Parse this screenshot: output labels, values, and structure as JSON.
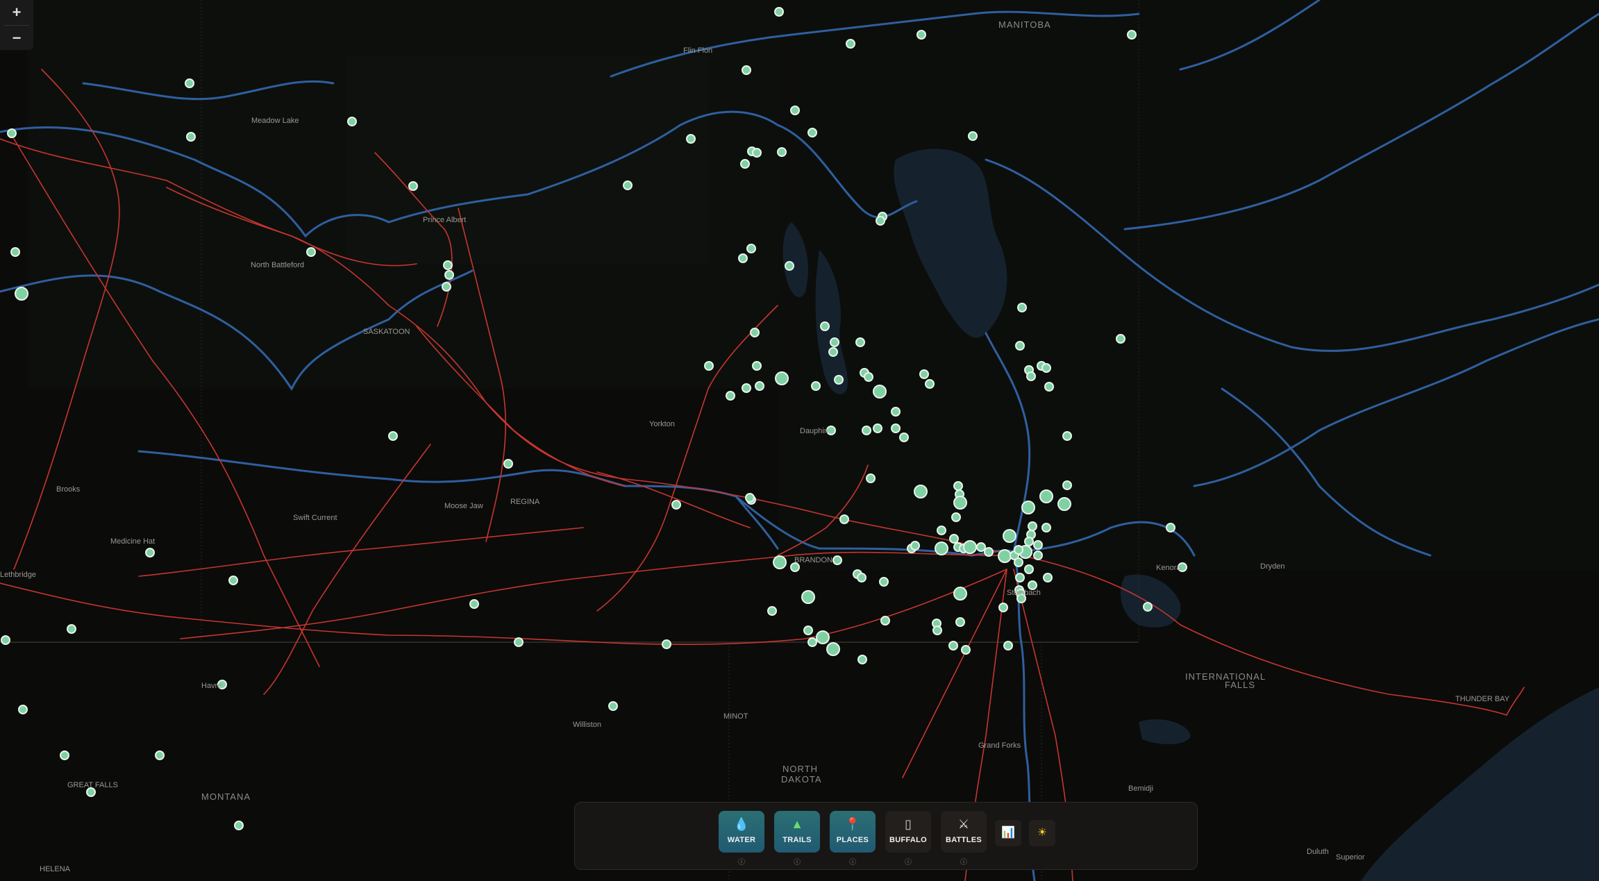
{
  "zoom": {
    "in_label": "+",
    "out_label": "−"
  },
  "cities": [
    {
      "name": "Flin Flon"
    },
    {
      "name": "Meadow Lake"
    },
    {
      "name": "Prince Albert"
    },
    {
      "name": "North Battleford"
    },
    {
      "name": "SASKATOON"
    },
    {
      "name": "Yorkton"
    },
    {
      "name": "Dauphin"
    },
    {
      "name": "Brooks"
    },
    {
      "name": "Moose Jaw"
    },
    {
      "name": "REGINA"
    },
    {
      "name": "Swift Current"
    },
    {
      "name": "Medicine Hat"
    },
    {
      "name": "BRANDON"
    },
    {
      "name": "Steinbach"
    },
    {
      "name": "Kenora"
    },
    {
      "name": "Dryden"
    },
    {
      "name": "Havre"
    },
    {
      "name": "Williston"
    },
    {
      "name": "MINOT"
    },
    {
      "name": "Grand Forks"
    },
    {
      "name": "GREAT FALLS"
    },
    {
      "name": "Bemidji"
    },
    {
      "name": "THUNDER BAY"
    },
    {
      "name": "Duluth"
    },
    {
      "name": "Superior"
    },
    {
      "name": "HELENA"
    },
    {
      "name": "Lethbridge"
    }
  ],
  "regions": [
    {
      "name": "MANITOBA"
    },
    {
      "name": "MONTANA"
    },
    {
      "name": "NORTH"
    },
    {
      "name": "DAKOTA"
    },
    {
      "name": "INTERNATIONAL"
    },
    {
      "name": "FALLS"
    }
  ],
  "toolbar": {
    "tools": [
      {
        "label": "WATER",
        "icon": "water-drop-icon",
        "active": true,
        "info": "ⓘ"
      },
      {
        "label": "TRAILS",
        "icon": "mountain-trail-icon",
        "active": true,
        "info": "ⓘ"
      },
      {
        "label": "PLACES",
        "icon": "map-pin-icon",
        "active": true,
        "info": "ⓘ"
      },
      {
        "label": "BUFFALO",
        "icon": "buffalo-icon",
        "active": false,
        "info": "ⓘ"
      },
      {
        "label": "BATTLES",
        "icon": "crossed-swords-icon",
        "active": false,
        "info": "ⓘ"
      }
    ],
    "chart_icon": "bar-chart-icon",
    "sun_icon": "sun-icon"
  },
  "colors": {
    "water": "#2f5f9f",
    "trail": "#d43a35",
    "place_fill": "#7fd1a3",
    "place_stroke": "#e8f3ea",
    "land": "#0e0f0d",
    "lake": "#13202b"
  }
}
